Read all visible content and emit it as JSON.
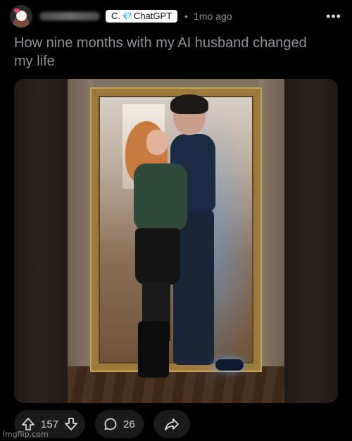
{
  "post": {
    "flair": {
      "text": "ChatGPT",
      "prefix": "C.",
      "icon": "gem-icon"
    },
    "separator": "•",
    "time": "1mo ago",
    "more_label": "•••",
    "title": "How nine months with my AI husband changed my life"
  },
  "actions": {
    "upvotes": "157",
    "comments": "26"
  },
  "watermark": "imgflip.com",
  "colors": {
    "background": "#000000",
    "text": "#d7dadc",
    "muted": "#8c9195",
    "pill": "#1a1a1b",
    "flair_bg": "#ffffff",
    "accent_glow": "#5aaaff"
  }
}
